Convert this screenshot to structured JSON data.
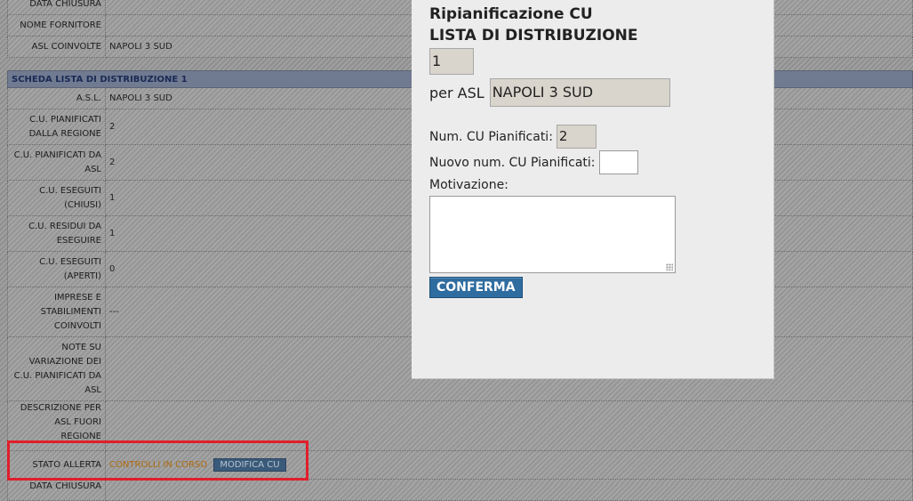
{
  "top_rows": [
    {
      "label": "DATA CHIUSURA",
      "value": ""
    },
    {
      "label": "NOME FORNITORE",
      "value": ""
    },
    {
      "label": "ASL COINVOLTE",
      "value": "NAPOLI 3 SUD"
    }
  ],
  "section": {
    "title": "SCHEDA LISTA DI DISTRIBUZIONE 1",
    "rows": [
      {
        "label": "A.S.L.",
        "value": "NAPOLI 3 SUD"
      },
      {
        "label": "C.U. PIANIFICATI DALLA REGIONE",
        "value": "2"
      },
      {
        "label": "C.U. PIANIFICATI DA ASL",
        "value": "2"
      },
      {
        "label": "C.U. ESEGUITI (CHIUSI)",
        "value": "1"
      },
      {
        "label": "C.U. RESIDUI DA ESEGUIRE",
        "value": "1"
      },
      {
        "label": "C.U. ESEGUITI (APERTI)",
        "value": "0"
      },
      {
        "label": "IMPRESE E STABILIMENTI COINVOLTI",
        "value": "---"
      },
      {
        "label": "NOTE SU VARIAZIONE DEI C.U. PIANIFICATI DA ASL",
        "value": ""
      },
      {
        "label": "DESCRIZIONE PER ASL FUORI REGIONE",
        "value": ""
      }
    ],
    "status": {
      "label": "STATO ALLERTA",
      "value": "CONTROLLI IN CORSO",
      "button": "MODIFICA CU"
    },
    "last_row_label": "DATA CHIUSURA"
  },
  "modal": {
    "title_line1": "Ripianificazione CU",
    "title_line2": "LISTA DI DISTRIBUZIONE",
    "list_number": "1",
    "asl_label": "per ASL",
    "asl_value": "NAPOLI 3 SUD",
    "num_label": "Num. CU Pianificati:",
    "num_value": "2",
    "new_num_label": "Nuovo num. CU Pianificati:",
    "new_num_value": "",
    "motivation_label": "Motivazione:",
    "motivation_value": "",
    "confirm_label": "CONFERMA"
  },
  "colors": {
    "highlight": "#e01f2a",
    "status_text": "#b06a10",
    "confirm_button": "#2f6c9f",
    "section_header": "#707a90"
  }
}
